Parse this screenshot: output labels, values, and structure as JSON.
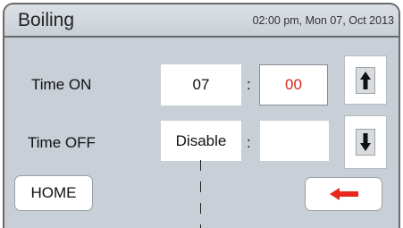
{
  "header": {
    "title": "Boiling",
    "datetime": "02:00 pm, Mon 07, Oct 2013"
  },
  "rows": {
    "time_on": {
      "label": "Time ON",
      "hour": "07",
      "separator": ":",
      "minute": "00"
    },
    "time_off": {
      "label": "Time OFF",
      "value": "Disable",
      "separator": ":",
      "minute": ""
    }
  },
  "buttons": {
    "home": "HOME",
    "up_icon": "up-arrow-icon",
    "down_icon": "down-arrow-icon",
    "back_icon": "left-arrow-icon"
  },
  "colors": {
    "panel_background": "#c8cfd6",
    "minute_text": "#cc2a1e",
    "back_arrow": "#e8261c"
  }
}
